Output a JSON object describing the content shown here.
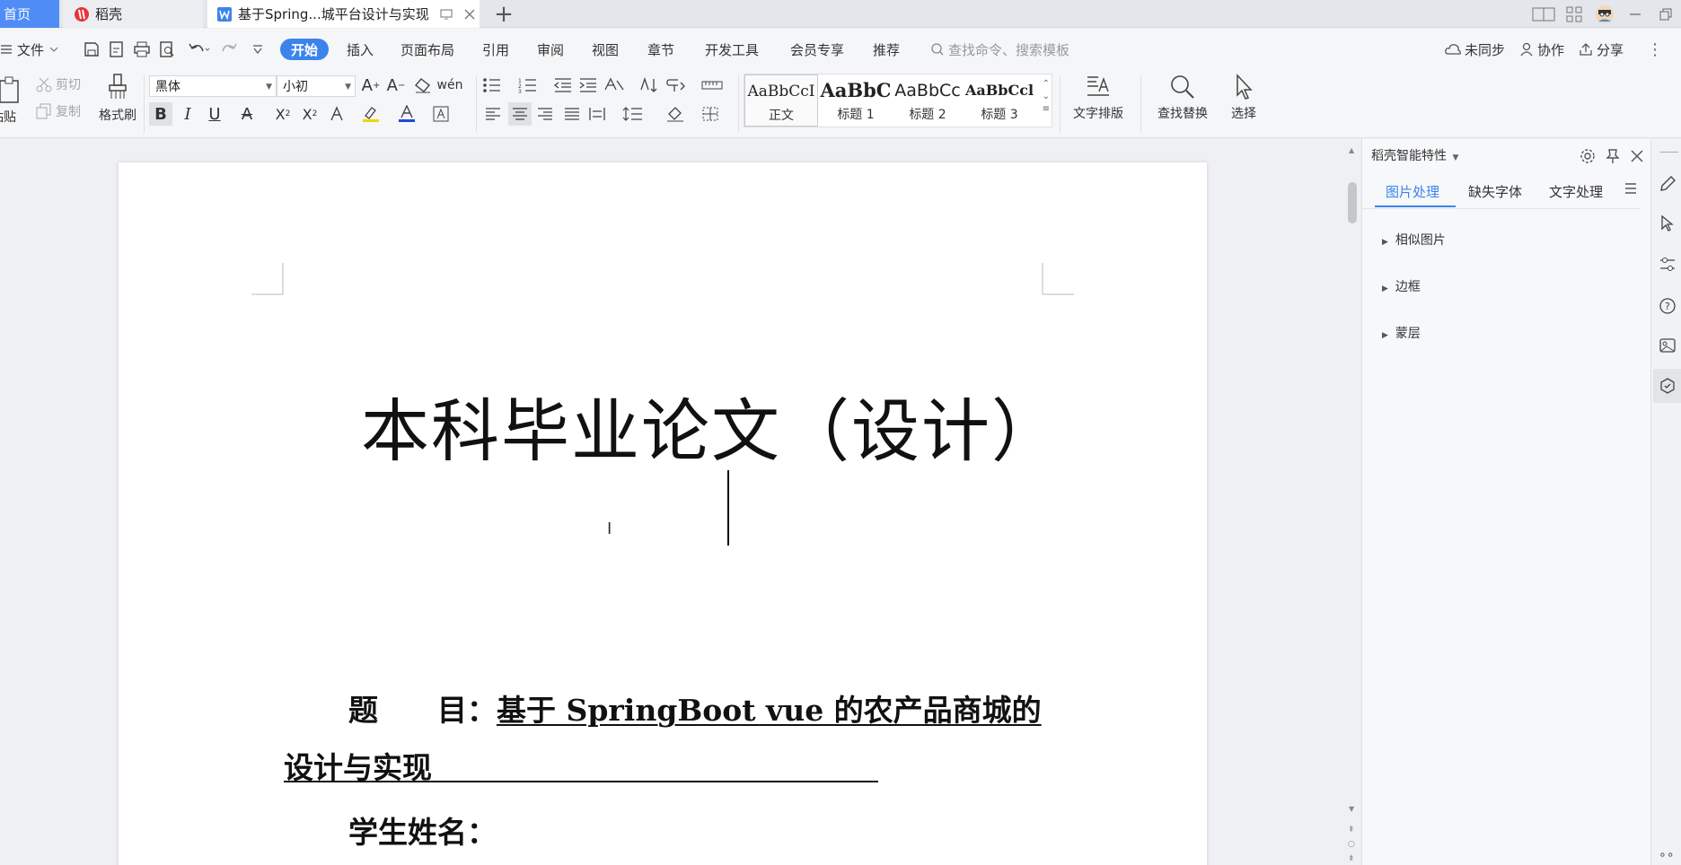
{
  "tabs": {
    "home": "首页",
    "daoke": "稻壳",
    "doc": "基于Spring...城平台设计与实现"
  },
  "menu": {
    "file": "文件",
    "items": [
      "开始",
      "插入",
      "页面布局",
      "引用",
      "审阅",
      "视图",
      "章节",
      "开发工具",
      "会员专享",
      "推荐"
    ],
    "search_placeholder": "查找命令、搜索模板",
    "unsynced": "未同步",
    "collab": "协作",
    "share": "分享"
  },
  "toolbar": {
    "paste": "粘贴",
    "cut": "剪切",
    "copy": "复制",
    "format_painter": "格式刷",
    "font_name": "黑体",
    "font_size": "小初",
    "styles": [
      {
        "preview": "AaBbCcI",
        "name": "正文"
      },
      {
        "preview": "AaBbC",
        "name": "标题 1"
      },
      {
        "preview": "AaBbCc",
        "name": "标题 2"
      },
      {
        "preview": "AaBbCcl",
        "name": "标题 3"
      }
    ],
    "text_layout": "文字排版",
    "find_replace": "查找替换",
    "select": "选择"
  },
  "document": {
    "title": "本科毕业论文（设计）",
    "topic_label": "题　　目：",
    "topic_value_1": "基于 SpringBoot vue 的农产品商城的",
    "topic_value_2": "设计与实现",
    "student_label": "学生姓名："
  },
  "panel": {
    "title": "稻壳智能特性",
    "tabs": [
      "图片处理",
      "缺失字体",
      "文字处理"
    ],
    "items": [
      "相似图片",
      "边框",
      "蒙层"
    ]
  },
  "colors": {
    "accent": "#3c84ec",
    "home_tab": "#4f8cf5",
    "daoke_logo": "#e8323c",
    "doc_icon": "#3c84ec"
  }
}
